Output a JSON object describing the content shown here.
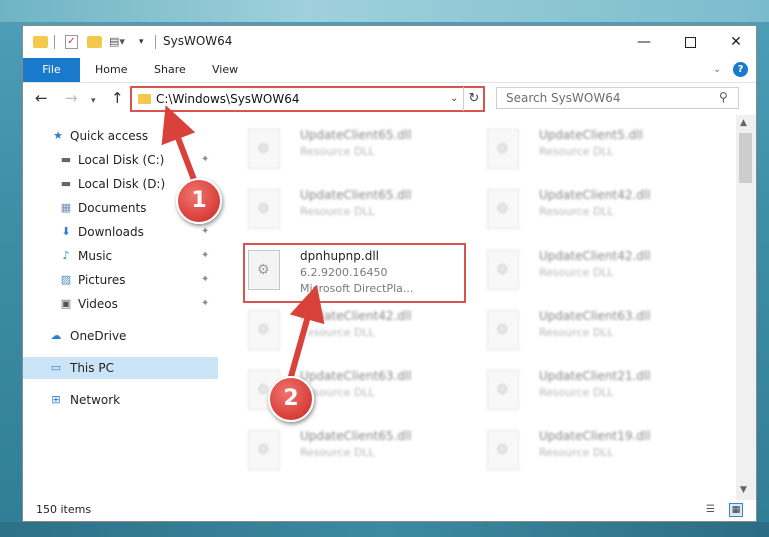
{
  "window": {
    "title": "SysWOW64",
    "controls": {
      "minimize": "—",
      "maximize": "",
      "close": "✕"
    }
  },
  "quick_access_toolbar": {
    "check_glyph": "✓",
    "props_glyph": "▤▾",
    "dropdown_glyph": "▾"
  },
  "ribbon": {
    "tabs": {
      "file": "File",
      "home": "Home",
      "share": "Share",
      "view": "View"
    },
    "collapse_glyph": "⌄",
    "help_glyph": "?"
  },
  "navigation": {
    "back_glyph": "←",
    "forward_glyph": "→",
    "recent_glyph": "▾",
    "up_glyph": "↑",
    "address": "C:\\Windows\\SysWOW64",
    "address_dropdown_glyph": "⌄",
    "refresh_glyph": "↻",
    "search_placeholder": "Search SysWOW64",
    "search_glyph": "⚲"
  },
  "sidebar": {
    "pin_glyph": "✦",
    "items": [
      {
        "label": "Quick access",
        "icon": "★",
        "pinned": false
      },
      {
        "label": "Local Disk (C:)",
        "icon": "▬",
        "pinned": true
      },
      {
        "label": "Local Disk (D:)",
        "icon": "▬",
        "pinned": false
      },
      {
        "label": "Documents",
        "icon": "▦",
        "pinned": true
      },
      {
        "label": "Downloads",
        "icon": "⬇",
        "pinned": true
      },
      {
        "label": "Music",
        "icon": "♪",
        "pinned": true
      },
      {
        "label": "Pictures",
        "icon": "▨",
        "pinned": true
      },
      {
        "label": "Videos",
        "icon": "▣",
        "pinned": true
      },
      {
        "label": "OneDrive",
        "icon": "☁",
        "pinned": false
      },
      {
        "label": "This PC",
        "icon": "▭",
        "pinned": false,
        "selected": true
      },
      {
        "label": "Network",
        "icon": "⊞",
        "pinned": false
      }
    ]
  },
  "files": {
    "gear_glyph": "⚙",
    "items": [
      {
        "name": "UpdateClient65.dll",
        "type": "Resource DLL",
        "blurred": true
      },
      {
        "name": "UpdateClient5.dll",
        "type": "Resource DLL",
        "blurred": true
      },
      {
        "name": "UpdateClient65.dll",
        "type": "Resource DLL",
        "blurred": true
      },
      {
        "name": "UpdateClient42.dll",
        "type": "Resource DLL",
        "blurred": true
      },
      {
        "name": "dpnhupnp.dll",
        "version": "6.2.9200.16450",
        "description": "Microsoft DirectPla...",
        "blurred": false
      },
      {
        "name": "UpdateClient42.dll",
        "type": "Resource DLL",
        "blurred": true
      },
      {
        "name": "UpdateClient42.dll",
        "type": "Resource DLL",
        "blurred": true
      },
      {
        "name": "UpdateClient63.dll",
        "type": "Resource DLL",
        "blurred": true
      },
      {
        "name": "UpdateClient63.dll",
        "type": "Resource DLL",
        "blurred": true
      },
      {
        "name": "UpdateClient21.dll",
        "type": "Resource DLL",
        "blurred": true
      },
      {
        "name": "UpdateClient65.dll",
        "type": "Resource DLL",
        "blurred": true
      },
      {
        "name": "UpdateClient19.dll",
        "type": "Resource DLL",
        "blurred": true
      }
    ]
  },
  "scrollbar": {
    "up_glyph": "▲",
    "down_glyph": "▼"
  },
  "status": {
    "item_count": "150 items",
    "details_view_glyph": "☰",
    "tiles_view_glyph": "▦"
  },
  "annotations": {
    "step_1": "1",
    "step_2": "2"
  },
  "colors": {
    "highlight": "#d9534f",
    "accent": "#1979ca",
    "selected": "#cce4f7"
  }
}
